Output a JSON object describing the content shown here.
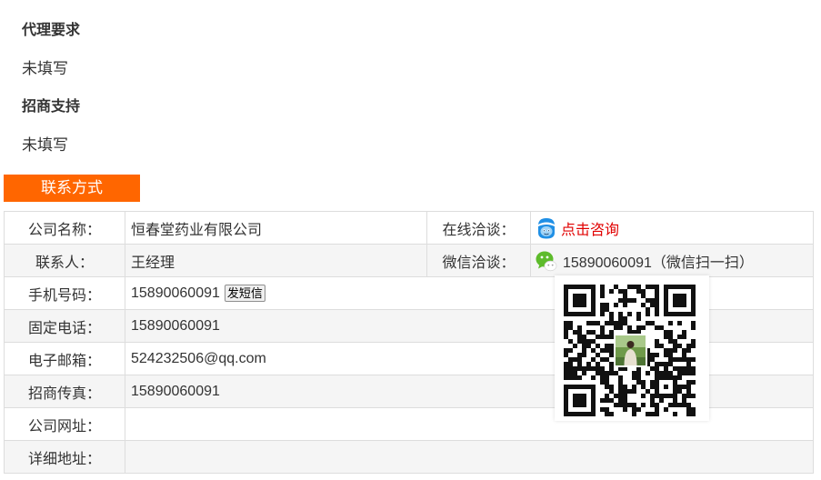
{
  "sections": [
    {
      "title": "代理要求",
      "value": "未填写"
    },
    {
      "title": "招商支持",
      "value": "未填写"
    }
  ],
  "contact": {
    "tab_label": "联系方式",
    "company_label": "公司名称：",
    "company_value": "恒春堂药业有限公司",
    "online_label": "在线洽谈：",
    "online_link": "点击咨询",
    "online_icon": "qq-chat-icon",
    "person_label": "联系人：",
    "person_value": "王经理",
    "wechat_label": "微信洽谈：",
    "wechat_value": "15890060091（微信扫一扫）",
    "wechat_icon": "wechat-icon",
    "mobile_label": "手机号码：",
    "mobile_value": "15890060091",
    "sms_button": "发短信",
    "phone_label": "固定电话：",
    "phone_value": "15890060091",
    "email_label": "电子邮箱：",
    "email_value": "524232506@qq.com",
    "fax_label": "招商传真：",
    "fax_value": "15890060091",
    "website_label": "公司网址：",
    "address_label": "详细地址：",
    "qr_icon": "wechat-qr-code"
  },
  "colors": {
    "accent": "#ff6600",
    "link": "#e10000",
    "row_alt": "#f5f5f5",
    "border": "#dddddd",
    "text": "#333333",
    "wechat": "#5dbb2b",
    "qq": "#1f8fe5"
  }
}
